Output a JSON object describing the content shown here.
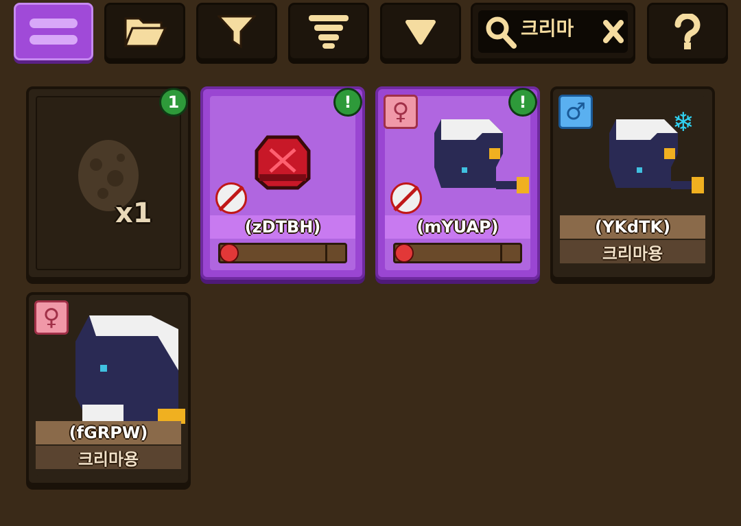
{
  "toolbar": {
    "search_query": "크리마"
  },
  "colors": {
    "accent_purple": "#a04ad8",
    "background": "#3a2a18",
    "badge_green": "#2e9a3a"
  },
  "cards": [
    {
      "id": "egg",
      "kind": "egg",
      "badge": "1",
      "count": "x1"
    },
    {
      "id": "zdtbh",
      "kind": "egg-ruby",
      "badge": "!",
      "name": "(zDTBH)",
      "status_icon": "no-breed-icon",
      "mood_icon": "angry-face-icon",
      "progress": 0.0
    },
    {
      "id": "myuap",
      "kind": "dragon",
      "badge": "!",
      "gender": "female",
      "name": "(mYUAP)",
      "status_icon": "no-breed-icon",
      "mood_icon": "angry-face-icon",
      "progress": 0.0
    },
    {
      "id": "ykdtk",
      "kind": "dragon",
      "gender": "male",
      "name": "(YKdTK)",
      "species": "크리마용",
      "extra_icon": "snowflake-icon"
    },
    {
      "id": "fgrpw",
      "kind": "dragon",
      "gender": "female",
      "name": "(fGRPW)",
      "species": "크리마용"
    }
  ],
  "icons": {
    "menu": "hamburger-menu-icon",
    "folder": "folder-open-icon",
    "filter": "filter-funnel-icon",
    "sort": "sort-lines-icon",
    "dropdown": "triangle-down-icon",
    "search": "search-icon",
    "clear": "close-x-icon",
    "help": "question-mark-icon"
  },
  "genders": {
    "female": "♀",
    "male": "♂"
  }
}
